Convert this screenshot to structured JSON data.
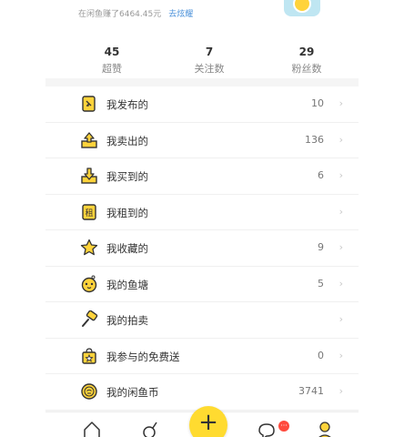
{
  "header": {
    "earnings_text": "在闲鱼赚了6464.45元",
    "show_off_link": "去炫耀"
  },
  "stats": [
    {
      "value": "45",
      "label": "超赞"
    },
    {
      "value": "7",
      "label": "关注数"
    },
    {
      "value": "29",
      "label": "粉丝数"
    }
  ],
  "menu": [
    {
      "label": "我发布的",
      "count": "10",
      "icon": "published-doc-icon"
    },
    {
      "label": "我卖出的",
      "count": "136",
      "icon": "sold-box-icon"
    },
    {
      "label": "我买到的",
      "count": "6",
      "icon": "bought-box-icon"
    },
    {
      "label": "我租到的",
      "count": "",
      "icon": "rent-tag-icon",
      "icon_text": "租"
    },
    {
      "label": "我收藏的",
      "count": "9",
      "icon": "star-icon"
    },
    {
      "label": "我的鱼塘",
      "count": "5",
      "icon": "fishpond-icon"
    },
    {
      "label": "我的拍卖",
      "count": "",
      "icon": "auction-hammer-icon"
    },
    {
      "label": "我参与的免费送",
      "count": "0",
      "icon": "gift-bag-icon"
    },
    {
      "label": "我的闲鱼币",
      "count": "3741",
      "icon": "coin-icon"
    }
  ],
  "tabbar": {
    "publish_symbol": "+",
    "message_badge": "···"
  },
  "colors": {
    "accent": "#ffdb30",
    "icon_yellow": "#ffd33b",
    "badge": "#ff4a3d",
    "link": "#4a90d9"
  }
}
